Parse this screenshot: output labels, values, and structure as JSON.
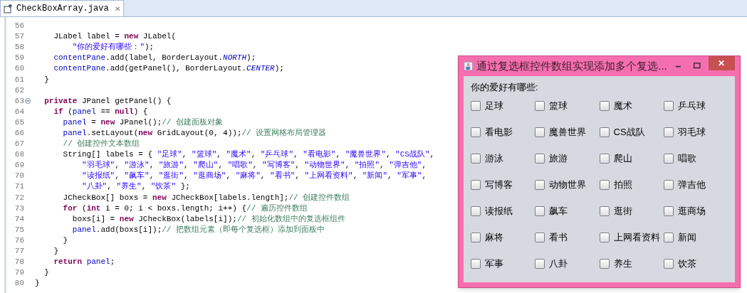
{
  "editor_tab": {
    "title": "CheckBoxArray.java",
    "close": "✕"
  },
  "code_lines": [
    {
      "number": "56",
      "fold": false
    },
    {
      "number": "57",
      "fold": false,
      "tokens": [
        {
          "kind": "plain",
          "text": "\t\tJLabel label = "
        },
        {
          "kind": "keyword",
          "text": "new"
        },
        {
          "kind": "plain",
          "text": " JLabel("
        }
      ]
    },
    {
      "number": "58",
      "fold": false,
      "tokens": [
        {
          "kind": "string",
          "text": "\t\t\t\t\"你的爱好有哪些：\""
        },
        {
          "kind": "plain",
          "text": ");"
        }
      ]
    },
    {
      "number": "59",
      "fold": false,
      "tokens": [
        {
          "kind": "field",
          "text": "\t\tcontentPane"
        },
        {
          "kind": "plain",
          "text": ".add(label, BorderLayout."
        },
        {
          "kind": "constant",
          "text": "NORTH"
        },
        {
          "kind": "plain",
          "text": ");"
        }
      ]
    },
    {
      "number": "60",
      "fold": false,
      "tokens": [
        {
          "kind": "field",
          "text": "\t\tcontentPane"
        },
        {
          "kind": "plain",
          "text": ".add(getPanel(), BorderLayout."
        },
        {
          "kind": "constant",
          "text": "CENTER"
        },
        {
          "kind": "plain",
          "text": ");"
        }
      ]
    },
    {
      "number": "61",
      "fold": false,
      "tokens": [
        {
          "kind": "plain",
          "text": "\t}"
        }
      ]
    },
    {
      "number": "62",
      "fold": false
    },
    {
      "number": "63",
      "fold": true,
      "tokens": [
        {
          "kind": "keyword",
          "text": "\tprivate"
        },
        {
          "kind": "plain",
          "text": " JPanel getPanel() {"
        }
      ]
    },
    {
      "number": "64",
      "fold": false,
      "tokens": [
        {
          "kind": "keyword",
          "text": "\t\tif"
        },
        {
          "kind": "plain",
          "text": " ("
        },
        {
          "kind": "field",
          "text": "panel"
        },
        {
          "kind": "plain",
          "text": " == "
        },
        {
          "kind": "keyword",
          "text": "null"
        },
        {
          "kind": "plain",
          "text": ") {"
        }
      ]
    },
    {
      "number": "65",
      "fold": false,
      "tokens": [
        {
          "kind": "field",
          "text": "\t\t\tpanel"
        },
        {
          "kind": "plain",
          "text": " = "
        },
        {
          "kind": "keyword",
          "text": "new"
        },
        {
          "kind": "plain",
          "text": " JPanel();"
        },
        {
          "kind": "comment",
          "text": "// 创建面板对象"
        }
      ]
    },
    {
      "number": "66",
      "fold": false,
      "tokens": [
        {
          "kind": "field",
          "text": "\t\t\tpanel"
        },
        {
          "kind": "plain",
          "text": ".setLayout("
        },
        {
          "kind": "keyword",
          "text": "new"
        },
        {
          "kind": "plain",
          "text": " GridLayout(0, 4));"
        },
        {
          "kind": "comment",
          "text": "// 设置网格布局管理器"
        }
      ]
    },
    {
      "number": "67",
      "fold": false,
      "tokens": [
        {
          "kind": "comment",
          "text": "\t\t\t// 创建控件文本数组"
        }
      ]
    },
    {
      "number": "68",
      "fold": false,
      "tokens": [
        {
          "kind": "plain",
          "text": "\t\t\tString[] labels = { "
        },
        {
          "kind": "string",
          "text": "\"足球\""
        },
        {
          "kind": "plain",
          "text": ", "
        },
        {
          "kind": "string",
          "text": "\"篮球\""
        },
        {
          "kind": "plain",
          "text": ", "
        },
        {
          "kind": "string",
          "text": "\"魔术\""
        },
        {
          "kind": "plain",
          "text": ", "
        },
        {
          "kind": "string",
          "text": "\"乒乓球\""
        },
        {
          "kind": "plain",
          "text": ", "
        },
        {
          "kind": "string",
          "text": "\"看电影\""
        },
        {
          "kind": "plain",
          "text": ", "
        },
        {
          "kind": "string",
          "text": "\"魔兽世界\""
        },
        {
          "kind": "plain",
          "text": ", "
        },
        {
          "kind": "string",
          "text": "\"CS战队\""
        },
        {
          "kind": "plain",
          "text": ","
        }
      ]
    },
    {
      "number": "69",
      "fold": false,
      "tokens": [
        {
          "kind": "string",
          "text": "\t\t\t\t\t\"羽毛球\""
        },
        {
          "kind": "plain",
          "text": ", "
        },
        {
          "kind": "string",
          "text": "\"游泳\""
        },
        {
          "kind": "plain",
          "text": ", "
        },
        {
          "kind": "string",
          "text": "\"旅游\""
        },
        {
          "kind": "plain",
          "text": ", "
        },
        {
          "kind": "string",
          "text": "\"爬山\""
        },
        {
          "kind": "plain",
          "text": ", "
        },
        {
          "kind": "string",
          "text": "\"唱歌\""
        },
        {
          "kind": "plain",
          "text": ", "
        },
        {
          "kind": "string",
          "text": "\"写博客\""
        },
        {
          "kind": "plain",
          "text": ", "
        },
        {
          "kind": "string",
          "text": "\"动物世界\""
        },
        {
          "kind": "plain",
          "text": ", "
        },
        {
          "kind": "string",
          "text": "\"拍照\""
        },
        {
          "kind": "plain",
          "text": ", "
        },
        {
          "kind": "string",
          "text": "\"弹吉他\""
        },
        {
          "kind": "plain",
          "text": ","
        }
      ]
    },
    {
      "number": "70",
      "fold": false,
      "tokens": [
        {
          "kind": "string",
          "text": "\t\t\t\t\t\"读报纸\""
        },
        {
          "kind": "plain",
          "text": ", "
        },
        {
          "kind": "string",
          "text": "\"飙车\""
        },
        {
          "kind": "plain",
          "text": ", "
        },
        {
          "kind": "string",
          "text": "\"逛街\""
        },
        {
          "kind": "plain",
          "text": ", "
        },
        {
          "kind": "string",
          "text": "\"逛商场\""
        },
        {
          "kind": "plain",
          "text": ", "
        },
        {
          "kind": "string",
          "text": "\"麻将\""
        },
        {
          "kind": "plain",
          "text": ", "
        },
        {
          "kind": "string",
          "text": "\"看书\""
        },
        {
          "kind": "plain",
          "text": ", "
        },
        {
          "kind": "string",
          "text": "\"上网看资料\""
        },
        {
          "kind": "plain",
          "text": ", "
        },
        {
          "kind": "string",
          "text": "\"新闻\""
        },
        {
          "kind": "plain",
          "text": ", "
        },
        {
          "kind": "string",
          "text": "\"军事\""
        },
        {
          "kind": "plain",
          "text": ","
        }
      ]
    },
    {
      "number": "71",
      "fold": false,
      "tokens": [
        {
          "kind": "string",
          "text": "\t\t\t\t\t\"八卦\""
        },
        {
          "kind": "plain",
          "text": ", "
        },
        {
          "kind": "string",
          "text": "\"养生\""
        },
        {
          "kind": "plain",
          "text": ", "
        },
        {
          "kind": "string",
          "text": "\"饮茶\""
        },
        {
          "kind": "plain",
          "text": " };"
        }
      ]
    },
    {
      "number": "72",
      "fold": false,
      "tokens": [
        {
          "kind": "plain",
          "text": "\t\t\tJCheckBox[] boxs = "
        },
        {
          "kind": "keyword",
          "text": "new"
        },
        {
          "kind": "plain",
          "text": " JCheckBox[labels.length];"
        },
        {
          "kind": "comment",
          "text": "// 创建控件数组"
        }
      ]
    },
    {
      "number": "73",
      "fold": false,
      "tokens": [
        {
          "kind": "keyword",
          "text": "\t\t\tfor"
        },
        {
          "kind": "plain",
          "text": " ("
        },
        {
          "kind": "keyword",
          "text": "int"
        },
        {
          "kind": "plain",
          "text": " i = 0; i < boxs.length; i++) {"
        },
        {
          "kind": "comment",
          "text": "// 遍历控件数组"
        }
      ]
    },
    {
      "number": "74",
      "fold": false,
      "tokens": [
        {
          "kind": "plain",
          "text": "\t\t\t\tboxs[i] = "
        },
        {
          "kind": "keyword",
          "text": "new"
        },
        {
          "kind": "plain",
          "text": " JCheckBox(labels[i]);"
        },
        {
          "kind": "comment",
          "text": "// 初始化数组中的复选框组件"
        }
      ]
    },
    {
      "number": "75",
      "fold": false,
      "tokens": [
        {
          "kind": "field",
          "text": "\t\t\t\tpanel"
        },
        {
          "kind": "plain",
          "text": ".add(boxs[i]);"
        },
        {
          "kind": "comment",
          "text": "// 把数组元素（即每个复选框）添加到面板中"
        }
      ]
    },
    {
      "number": "76",
      "fold": false,
      "tokens": [
        {
          "kind": "plain",
          "text": "\t\t\t}"
        }
      ]
    },
    {
      "number": "77",
      "fold": false,
      "tokens": [
        {
          "kind": "plain",
          "text": "\t\t}"
        }
      ]
    },
    {
      "number": "78",
      "fold": false,
      "tokens": [
        {
          "kind": "keyword",
          "text": "\t\treturn "
        },
        {
          "kind": "field",
          "text": "panel"
        },
        {
          "kind": "plain",
          "text": ";"
        }
      ]
    },
    {
      "number": "79",
      "fold": false,
      "tokens": [
        {
          "kind": "plain",
          "text": "\t}"
        }
      ]
    },
    {
      "number": "80",
      "fold": false,
      "tokens": [
        {
          "kind": "plain",
          "text": "}"
        }
      ]
    }
  ],
  "window": {
    "title": "通过复选框控件数组实现添加多个复选...",
    "minimize": "–",
    "close": "✕",
    "prompt": "你的爱好有哪些:",
    "checkboxes": [
      {
        "label": "足球",
        "checked": false
      },
      {
        "label": "篮球",
        "checked": false
      },
      {
        "label": "魔术",
        "checked": false
      },
      {
        "label": "乒乓球",
        "checked": false
      },
      {
        "label": "看电影",
        "checked": false
      },
      {
        "label": "魔兽世界",
        "checked": false
      },
      {
        "label": "CS战队",
        "checked": false
      },
      {
        "label": "羽毛球",
        "checked": false
      },
      {
        "label": "游泳",
        "checked": false
      },
      {
        "label": "旅游",
        "checked": false
      },
      {
        "label": "爬山",
        "checked": false
      },
      {
        "label": "唱歌",
        "checked": false
      },
      {
        "label": "写博客",
        "checked": false
      },
      {
        "label": "动物世界",
        "checked": false
      },
      {
        "label": "拍照",
        "checked": false
      },
      {
        "label": "弹吉他",
        "checked": false
      },
      {
        "label": "读报纸",
        "checked": false
      },
      {
        "label": "飙车",
        "checked": false
      },
      {
        "label": "逛街",
        "checked": false
      },
      {
        "label": "逛商场",
        "checked": false
      },
      {
        "label": "麻将",
        "checked": false
      },
      {
        "label": "看书",
        "checked": false
      },
      {
        "label": "上网看资料",
        "checked": false
      },
      {
        "label": "新闻",
        "checked": false
      },
      {
        "label": "军事",
        "checked": false
      },
      {
        "label": "八卦",
        "checked": false
      },
      {
        "label": "养生",
        "checked": false
      },
      {
        "label": "饮茶",
        "checked": false
      }
    ]
  }
}
